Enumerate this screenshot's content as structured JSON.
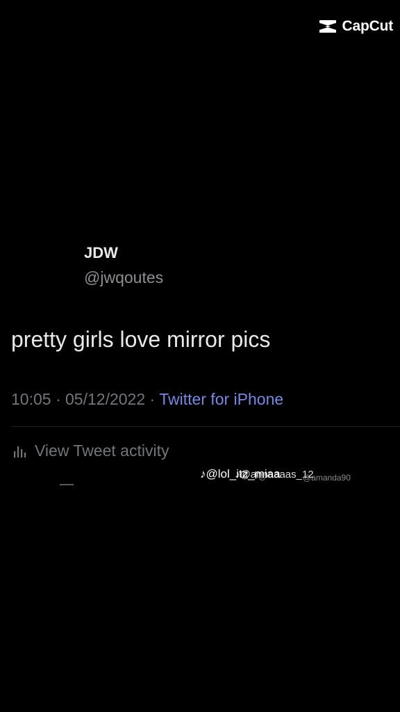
{
  "app": {
    "brand_label": "CapCut",
    "brand_icon": "capcut-logo-icon"
  },
  "tweet": {
    "author_name": "JDW",
    "author_handle": "@jwqoutes",
    "text": "pretty girls love mirror pics",
    "time": "10:05",
    "separator": "·",
    "date": "05/12/2022",
    "source": "Twitter for iPhone",
    "activity_label": "View Tweet activity",
    "activity_icon": "bar-chart-icon"
  },
  "watermarks": [
    "♪@lol_itz_miaa",
    "♪@annaaaas_12",
    "♪@",
    "@amanda90"
  ],
  "colors": {
    "background": "#000000",
    "text": "#e7e9ea",
    "secondary": "#71767b",
    "link": "#7b88e0"
  }
}
